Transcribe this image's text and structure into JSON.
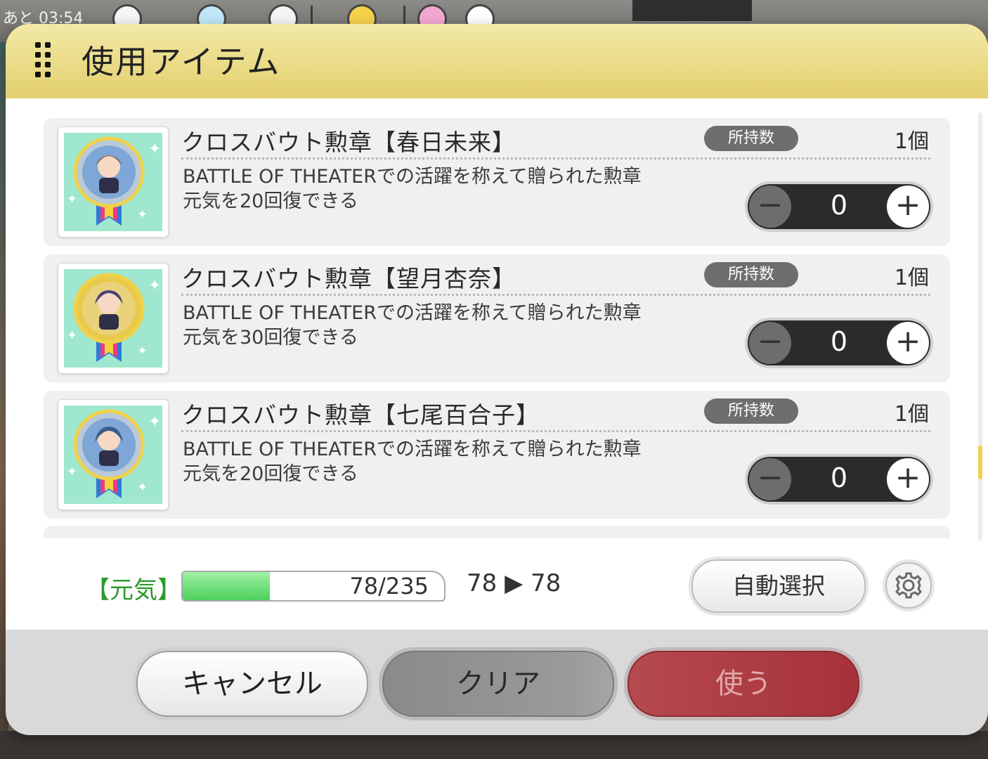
{
  "status": {
    "timer": "あと 03:54"
  },
  "dialog": {
    "title": "使用アイテム"
  },
  "items": [
    {
      "name": "クロスバウト勲章【春日未来】",
      "owned_label": "所持数",
      "owned_count": "1個",
      "desc_line1": "BATTLE OF THEATERでの活躍を称えて贈られた勲章",
      "desc_line2": "元気を20回復できる",
      "quantity": "0",
      "medal_color": "#b9c9d8"
    },
    {
      "name": "クロスバウト勲章【望月杏奈】",
      "owned_label": "所持数",
      "owned_count": "1個",
      "desc_line1": "BATTLE OF THEATERでの活躍を称えて贈られた勲章",
      "desc_line2": "元気を30回復できる",
      "quantity": "0",
      "medal_color": "#e8c94a"
    },
    {
      "name": "クロスバウト勲章【七尾百合子】",
      "owned_label": "所持数",
      "owned_count": "1個",
      "desc_line1": "BATTLE OF THEATERでの活躍を称えて贈られた勲章",
      "desc_line2": "元気を20回復できる",
      "quantity": "0",
      "medal_color": "#b9c9d8"
    }
  ],
  "energy": {
    "label": "【元気】",
    "bar_text": "78/235",
    "fill_ratio": 0.332,
    "change_text": "78 ▶ 78"
  },
  "buttons": {
    "auto_select": "自動選択",
    "cancel": "キャンセル",
    "clear": "クリア",
    "use": "使う"
  },
  "icons": {
    "minus": "−",
    "plus": "+"
  }
}
